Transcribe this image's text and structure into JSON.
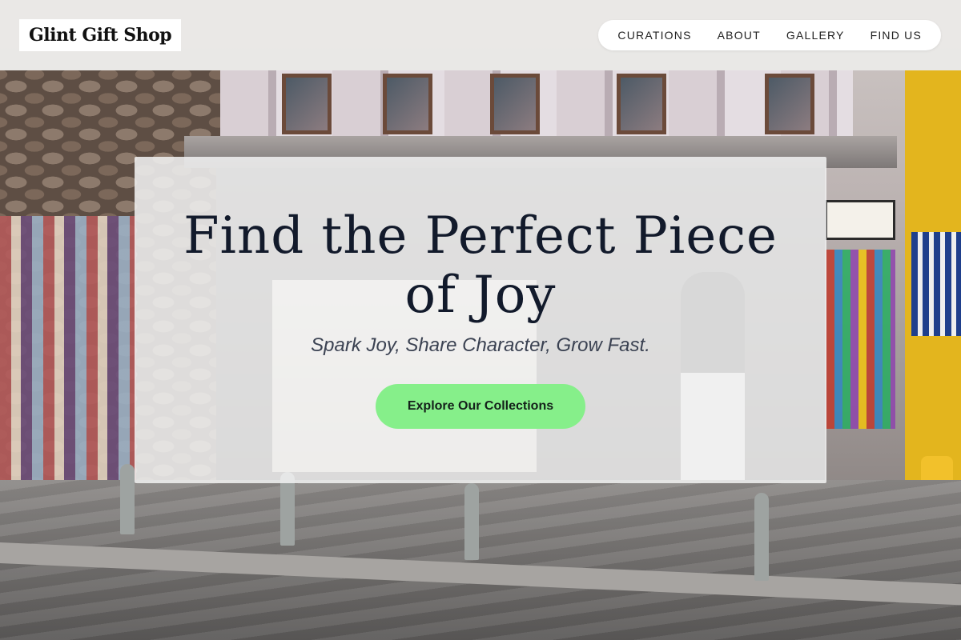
{
  "header": {
    "logo_text": "Glint Gift Shop",
    "nav": [
      {
        "label": "CURATIONS"
      },
      {
        "label": "ABOUT"
      },
      {
        "label": "GALLERY"
      },
      {
        "label": "FIND US"
      }
    ]
  },
  "hero": {
    "title": "Find the Perfect Piece of Joy",
    "tagline": "Spark Joy, Share Character, Grow Fast.",
    "cta_label": "Explore Our Collections"
  },
  "colors": {
    "cta_background": "#86ef8a",
    "title_text": "#121a2b",
    "header_background": "#eceae8"
  }
}
